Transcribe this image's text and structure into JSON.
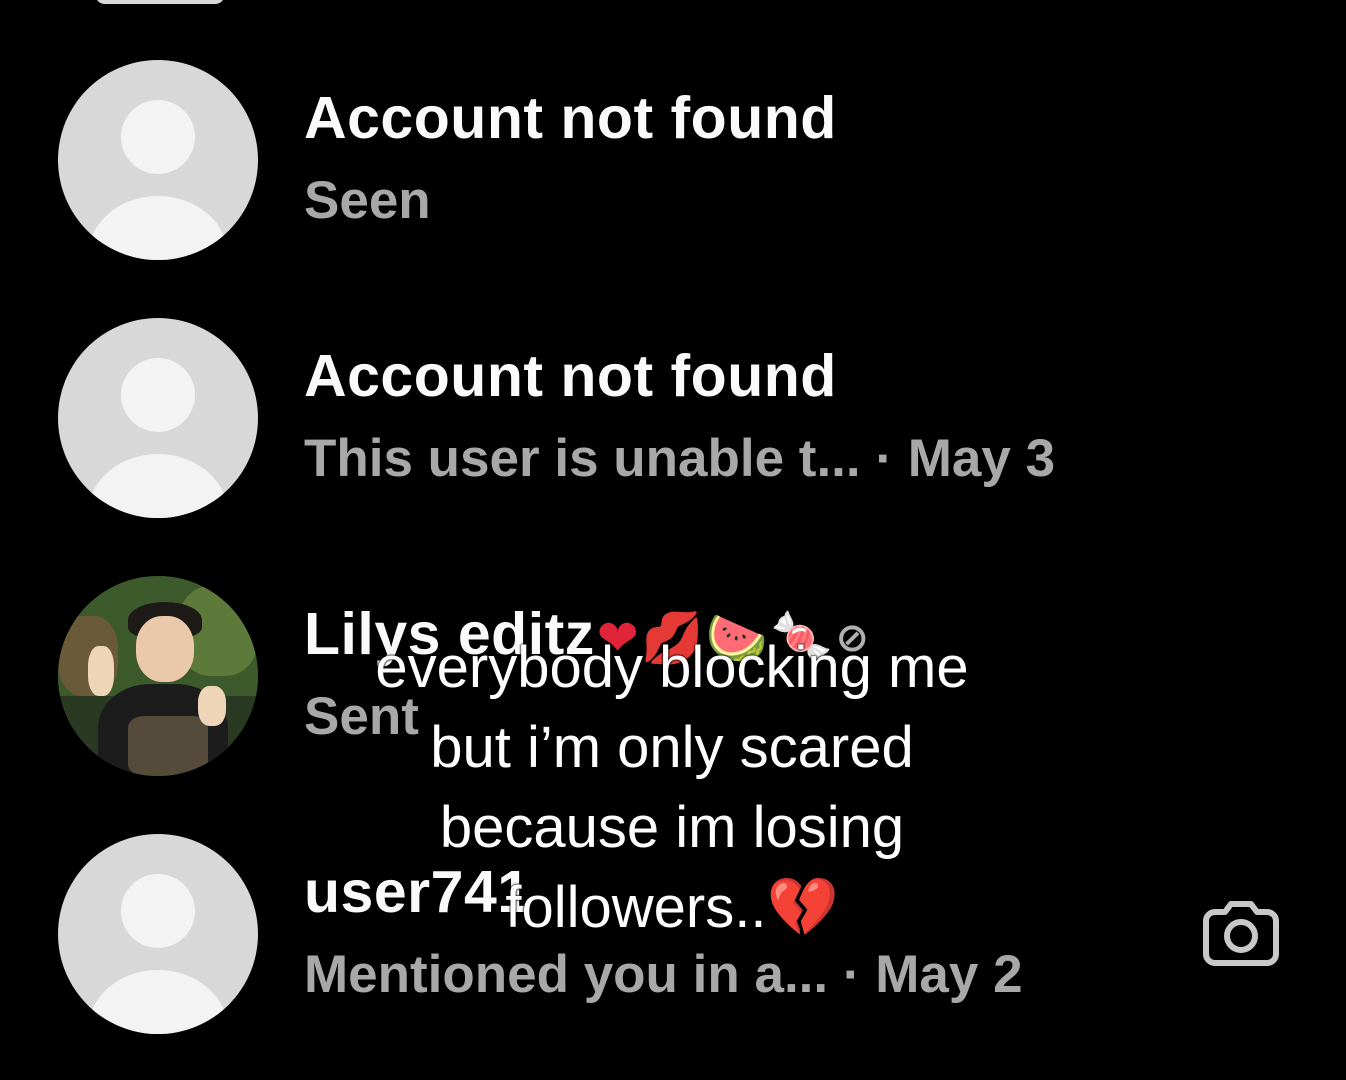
{
  "threads": [
    {
      "name": "Account not found",
      "preview": "Seen",
      "date": "",
      "avatar": "default-avatar"
    },
    {
      "name": "Account not found",
      "preview": "This user is unable t...",
      "separator": "·",
      "date": "May 3",
      "avatar": "default-avatar"
    },
    {
      "name": "Lilys editz",
      "name_emojis": [
        "❤",
        "💋",
        "🍉",
        "🍬",
        "⊘"
      ],
      "preview": "Sent",
      "date": "",
      "avatar": "photo-avatar"
    },
    {
      "name": "user741",
      "preview": "Mentioned you in a...",
      "separator": "·",
      "date": "May 2",
      "avatar": "default-avatar",
      "action_icon": "camera-icon"
    }
  ],
  "caption": {
    "line1": "everybody blocking me",
    "line2": "but i’m only scared",
    "line3": "because im losing",
    "line4": "followers..",
    "emoji": "💔"
  },
  "colors": {
    "background": "#000000",
    "primary_text": "#fafafa",
    "secondary_text": "#a8a8a8",
    "avatar_bg": "#d8d8d8"
  }
}
